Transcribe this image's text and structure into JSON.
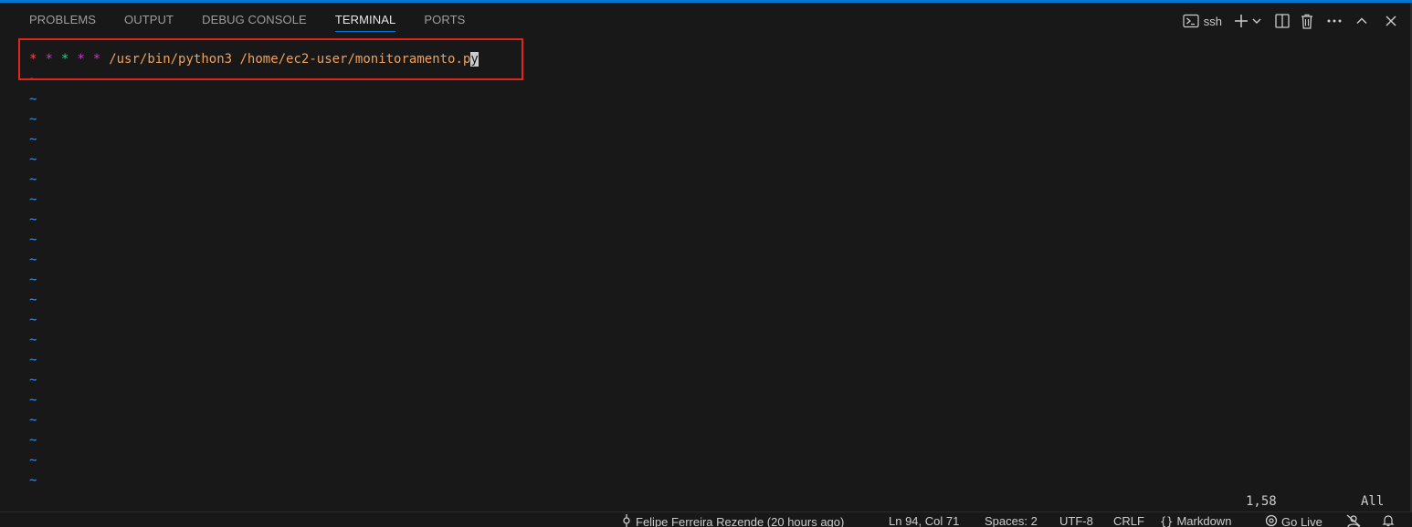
{
  "tabs": [
    {
      "label": "PROBLEMS"
    },
    {
      "label": "OUTPUT"
    },
    {
      "label": "DEBUG CONSOLE"
    },
    {
      "label": "TERMINAL"
    },
    {
      "label": "PORTS"
    }
  ],
  "active_tab": "TERMINAL",
  "actions": {
    "terminal_name": "ssh",
    "icons": [
      "terminal-icon",
      "plus-icon",
      "chevron-down-icon",
      "split-icon",
      "trash-icon",
      "more-icon",
      "chevron-up-icon",
      "close-icon"
    ]
  },
  "terminal": {
    "stars": [
      "*",
      "*",
      "*",
      "*",
      "*"
    ],
    "star_colors": [
      "#f14c4c",
      "#bc3fbc",
      "#23d18b",
      "#bc3fbc",
      "#bc3fbc"
    ],
    "command_main": "/usr/bin/python3 /home/ec2-user/monitoramento.p",
    "command_cursor_char": "y",
    "tilde": "~",
    "tilde_line_count": 21
  },
  "vim_status": {
    "position": "1,58",
    "scroll": "All"
  },
  "statusbar": {
    "blame": "Felipe Ferreira Rezende (20 hours ago)",
    "cursor": "Ln 94, Col 71",
    "spaces": "Spaces: 2",
    "encoding": "UTF-8",
    "eol": "CRLF",
    "language": "Markdown",
    "golive": "Go Live"
  },
  "colors": {
    "accent": "#0078d4",
    "highlight_box": "#e1251b",
    "command": "#f0a05a",
    "tilde": "#3b8eea"
  }
}
